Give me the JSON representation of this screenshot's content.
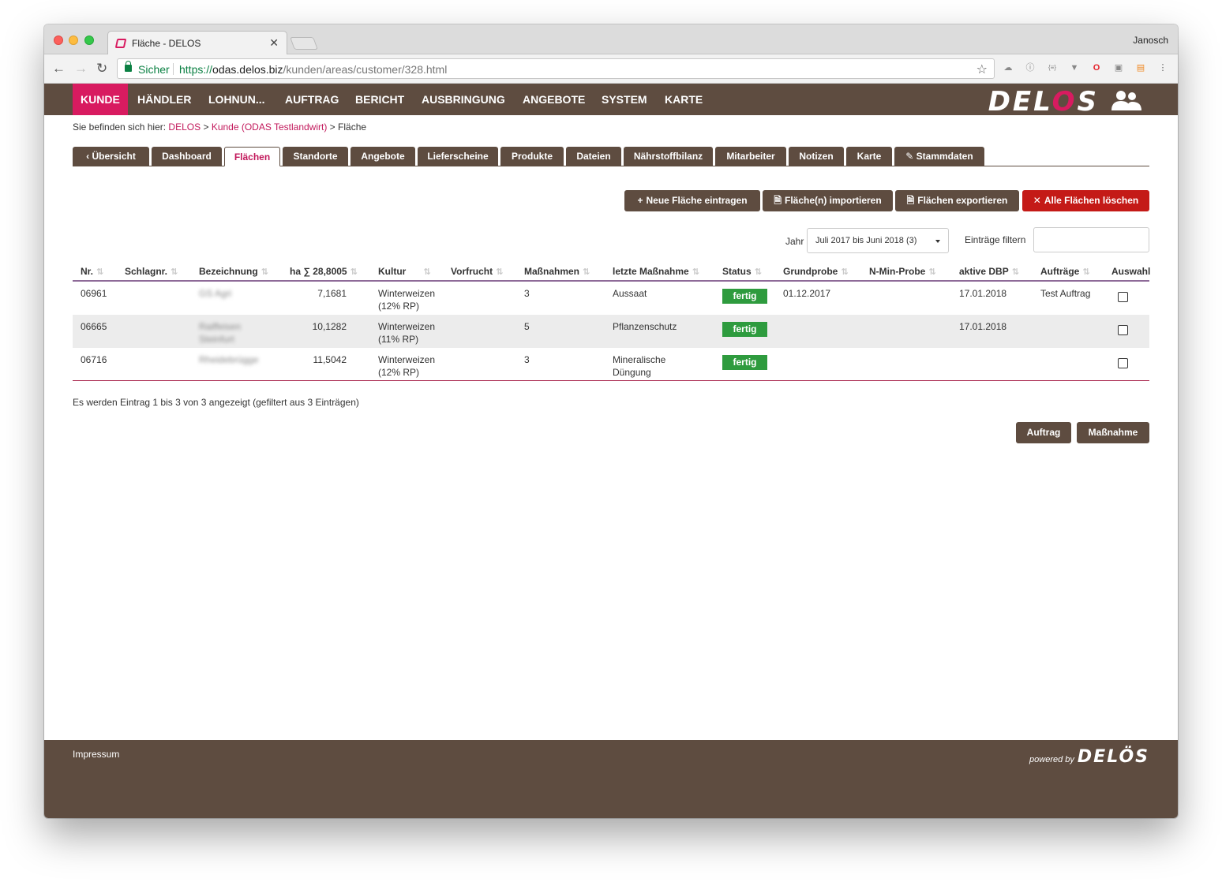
{
  "browser": {
    "tab_title": "Fläche - DELOS",
    "profile_name": "Janosch",
    "secure_label": "Sicher",
    "url_protocol": "https://",
    "url_host": "odas.delos.biz",
    "url_path": "/kunden/areas/customer/328.html"
  },
  "nav": {
    "items": [
      "KUNDE",
      "HÄNDLER",
      "LOHNUN...",
      "AUFTRAG",
      "BERICHT",
      "AUSBRINGUNG",
      "ANGEBOTE",
      "SYSTEM",
      "KARTE"
    ],
    "active_index": 0,
    "logo_text": [
      "DEL",
      "O",
      "S"
    ]
  },
  "breadcrumb": {
    "prefix": "Sie befinden sich hier:",
    "items": [
      "DELOS",
      "Kunde (ODAS Testlandwirt)",
      "Fläche"
    ],
    "separator": ">"
  },
  "tabs": [
    "Übersicht",
    "Dashboard",
    "Flächen",
    "Standorte",
    "Angebote",
    "Lieferscheine",
    "Produkte",
    "Dateien",
    "Nährstoffbilanz",
    "Mitarbeiter",
    "Notizen",
    "Karte",
    "Stammdaten"
  ],
  "active_tab_index": 2,
  "actions": {
    "new": "Neue Fläche eintragen",
    "import": "Fläche(n) importieren",
    "export": "Flächen exportieren",
    "delete_all": "Alle Flächen löschen"
  },
  "filters": {
    "year_label": "Jahr",
    "year_value": "Juli 2017 bis Juni 2018 (3)",
    "filter_label": "Einträge filtern",
    "filter_value": ""
  },
  "table": {
    "headers": {
      "nr": "Nr.",
      "schlagnr": "Schlagnr.",
      "bezeichnung": "Bezeichnung",
      "ha": "ha ∑ 28,8005",
      "kultur": "Kultur",
      "vorfrucht": "Vorfrucht",
      "massnahmen": "Maßnahmen",
      "letzte": "letzte Maßnahme",
      "status": "Status",
      "grundprobe": "Grundprobe",
      "nmin": "N-Min-Probe",
      "dbp": "aktive DBP",
      "auftraege": "Aufträge",
      "auswahl": "Auswahl"
    },
    "rows": [
      {
        "nr": "06961",
        "schlagnr": "",
        "bezeichnung": "GS Agri",
        "ha": "7,1681",
        "kultur_1": "Winterweizen",
        "kultur_2": "(12% RP)",
        "vorfrucht": "",
        "massnahmen": "3",
        "letzte_1": "Aussaat",
        "letzte_2": "",
        "status": "fertig",
        "grundprobe": "01.12.2017",
        "nmin": "",
        "dbp": "17.01.2018",
        "auftraege": "Test Auftrag"
      },
      {
        "nr": "06665",
        "schlagnr": "",
        "bezeichnung": "Raiffeisen Steinfurt",
        "ha": "10,1282",
        "kultur_1": "Winterweizen",
        "kultur_2": "(11% RP)",
        "vorfrucht": "",
        "massnahmen": "5",
        "letzte_1": "Pflanzenschutz",
        "letzte_2": "",
        "status": "fertig",
        "grundprobe": "",
        "nmin": "",
        "dbp": "17.01.2018",
        "auftraege": ""
      },
      {
        "nr": "06716",
        "schlagnr": "",
        "bezeichnung": "Rheidebrügge",
        "ha": "11,5042",
        "kultur_1": "Winterweizen",
        "kultur_2": "(12% RP)",
        "vorfrucht": "",
        "massnahmen": "3",
        "letzte_1": "Mineralische",
        "letzte_2": "Düngung",
        "status": "fertig",
        "grundprobe": "",
        "nmin": "",
        "dbp": "",
        "auftraege": ""
      }
    ]
  },
  "info_text": "Es werden Eintrag 1 bis 3 von 3 angezeigt (gefiltert aus 3 Einträgen)",
  "bottom_buttons": {
    "auftrag": "Auftrag",
    "massnahme": "Maßnahme"
  },
  "footer": {
    "impressum": "Impressum",
    "powered_by": "powered by",
    "brand": "DELÖS"
  },
  "colors": {
    "brown": "#5e4c40",
    "accent": "#d81b60",
    "danger": "#c41a17",
    "success": "#2e9b3e"
  }
}
